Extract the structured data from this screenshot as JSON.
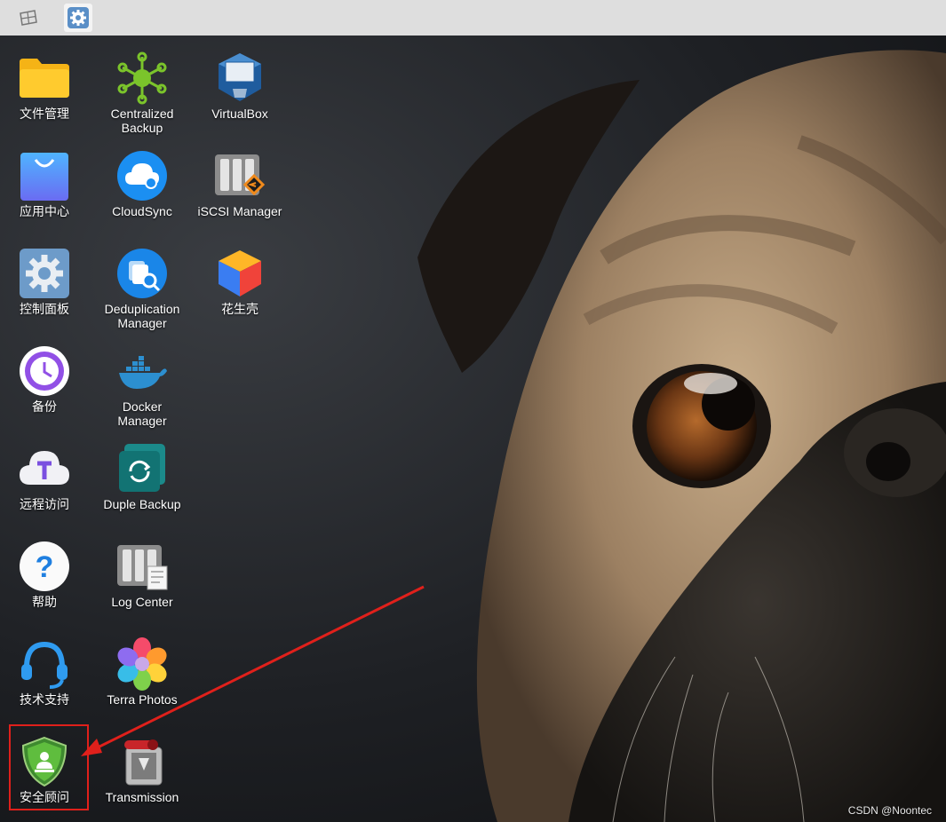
{
  "taskbar": {
    "buttons": [
      {
        "icon": "show-desktop-icon"
      },
      {
        "icon": "control-panel-gear-icon"
      }
    ]
  },
  "desktop": {
    "icons": [
      {
        "label": "文件管理",
        "icon": "folder-icon"
      },
      {
        "label": "应用中心",
        "icon": "shopping-bag-icon"
      },
      {
        "label": "控制面板",
        "icon": "gear-icon"
      },
      {
        "label": "备份",
        "icon": "backup-clock-icon"
      },
      {
        "label": "远程访问",
        "icon": "cloud-t-icon"
      },
      {
        "label": "帮助",
        "icon": "question-icon"
      },
      {
        "label": "技术支持",
        "icon": "headset-icon"
      },
      {
        "label": "安全顾问",
        "icon": "security-shield-icon"
      },
      {
        "label": "Centralized\nBackup",
        "icon": "network-nodes-icon"
      },
      {
        "label": "CloudSync",
        "icon": "cloud-sync-icon"
      },
      {
        "label": "Deduplication\nManager",
        "icon": "dedup-search-icon"
      },
      {
        "label": "Docker\nManager",
        "icon": "docker-whale-icon"
      },
      {
        "label": "Duple Backup",
        "icon": "duple-sync-icon"
      },
      {
        "label": "Log Center",
        "icon": "server-log-icon"
      },
      {
        "label": "Terra Photos",
        "icon": "flower-icon"
      },
      {
        "label": "Transmission",
        "icon": "transmission-icon"
      },
      {
        "label": "VirtualBox",
        "icon": "virtualbox-cube-icon"
      },
      {
        "label": "iSCSI Manager",
        "icon": "iscsi-server-icon"
      },
      {
        "label": "花生壳",
        "icon": "peanut-cube-icon"
      }
    ]
  },
  "watermark": "CSDN @Noontec",
  "colors": {
    "annotation": "#e0201b"
  }
}
